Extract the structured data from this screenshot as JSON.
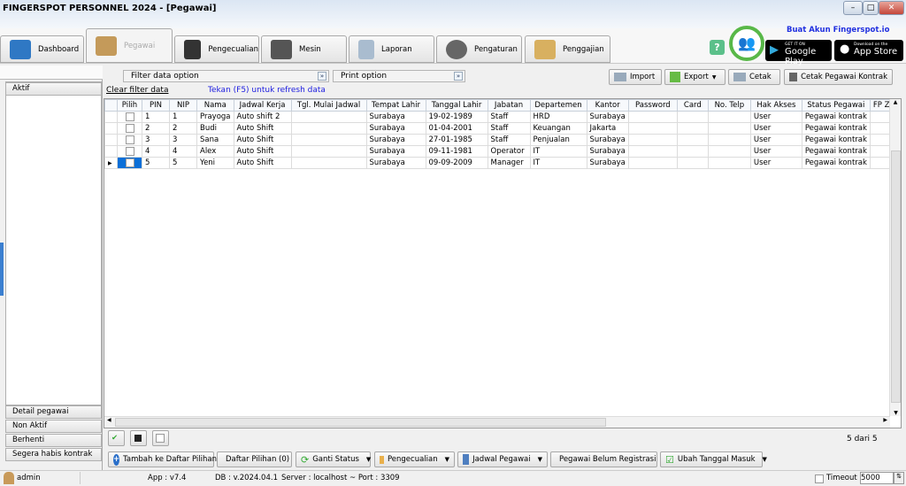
{
  "window": {
    "title": "FINGERSPOT PERSONNEL 2024 - [Pegawai]"
  },
  "tabs": [
    {
      "label": "Dashboard"
    },
    {
      "label": "Pegawai"
    },
    {
      "label": "Pengecualian"
    },
    {
      "label": "Mesin"
    },
    {
      "label": "Laporan"
    },
    {
      "label": "Pengaturan"
    },
    {
      "label": "Penggajian"
    }
  ],
  "promo": {
    "help": "?",
    "link": "Buat Akun Fingerspot.io",
    "google_small": "GET IT ON",
    "google": "Google Play",
    "apple_small": "Download on the",
    "apple": "App Store"
  },
  "filter": {
    "filter_option": "Filter data option",
    "print_option": "Print option",
    "clear": "Clear filter data",
    "hint": "Tekan (F5) untuk refresh data"
  },
  "toolbar": {
    "import": "Import",
    "export": "Export",
    "cetak": "Cetak",
    "cetak_kontrak": "Cetak Pegawai Kontrak"
  },
  "left": {
    "header": "Aktif",
    "items": [
      "Detail pegawai",
      "Non Aktif",
      "Berhenti",
      "Segera habis kontrak"
    ]
  },
  "table": {
    "columns": [
      "Pilih",
      "PIN",
      "NIP",
      "Nama",
      "Jadwal Kerja",
      "Tgl. Mulai Jadwal",
      "Tempat Lahir",
      "Tanggal Lahir",
      "Jabatan",
      "Departemen",
      "Kantor",
      "Password",
      "Card",
      "No. Telp",
      "Hak Akses",
      "Status Pegawai",
      "FP ZK"
    ],
    "rows": [
      [
        "",
        "1",
        "1",
        "Prayoga",
        "Auto shift 2",
        "",
        "Surabaya",
        "19-02-1989",
        "Staff",
        "HRD",
        "Surabaya",
        "",
        "",
        "",
        "User",
        "Pegawai kontrak",
        ""
      ],
      [
        "",
        "2",
        "2",
        "Budi",
        "Auto Shift",
        "",
        "Surabaya",
        "01-04-2001",
        "Staff",
        "Keuangan",
        "Jakarta",
        "",
        "",
        "",
        "User",
        "Pegawai kontrak",
        ""
      ],
      [
        "",
        "3",
        "3",
        "Sana",
        "Auto Shift",
        "",
        "Surabaya",
        "27-01-1985",
        "Staff",
        "Penjualan",
        "Surabaya",
        "",
        "",
        "",
        "User",
        "Pegawai kontrak",
        ""
      ],
      [
        "",
        "4",
        "4",
        "Alex",
        "Auto Shift",
        "",
        "Surabaya",
        "09-11-1981",
        "Operator",
        "IT",
        "Surabaya",
        "",
        "",
        "",
        "User",
        "Pegawai kontrak",
        ""
      ],
      [
        "",
        "5",
        "5",
        "Yeni",
        "Auto Shift",
        "",
        "Surabaya",
        "09-09-2009",
        "Manager",
        "IT",
        "Surabaya",
        "",
        "",
        "",
        "User",
        "Pegawai kontrak",
        ""
      ]
    ],
    "count": "5 dari 5"
  },
  "actions": {
    "tambah": "Tambah ke Daftar Pilihan",
    "daftar": "Daftar Pilihan (0)",
    "ganti": "Ganti Status",
    "pengecualian": "Pengecualian",
    "jadwal": "Jadwal Pegawai",
    "belum": "Pegawai Belum Registrasi",
    "ubah": "Ubah Tanggal Masuk"
  },
  "status": {
    "user": "admin",
    "app": "App : v7.4",
    "db": "DB : v.2024.04.1",
    "server": "Server : localhost ~ Port : 3309",
    "timeout_label": "Timeout :",
    "timeout": "5000"
  }
}
